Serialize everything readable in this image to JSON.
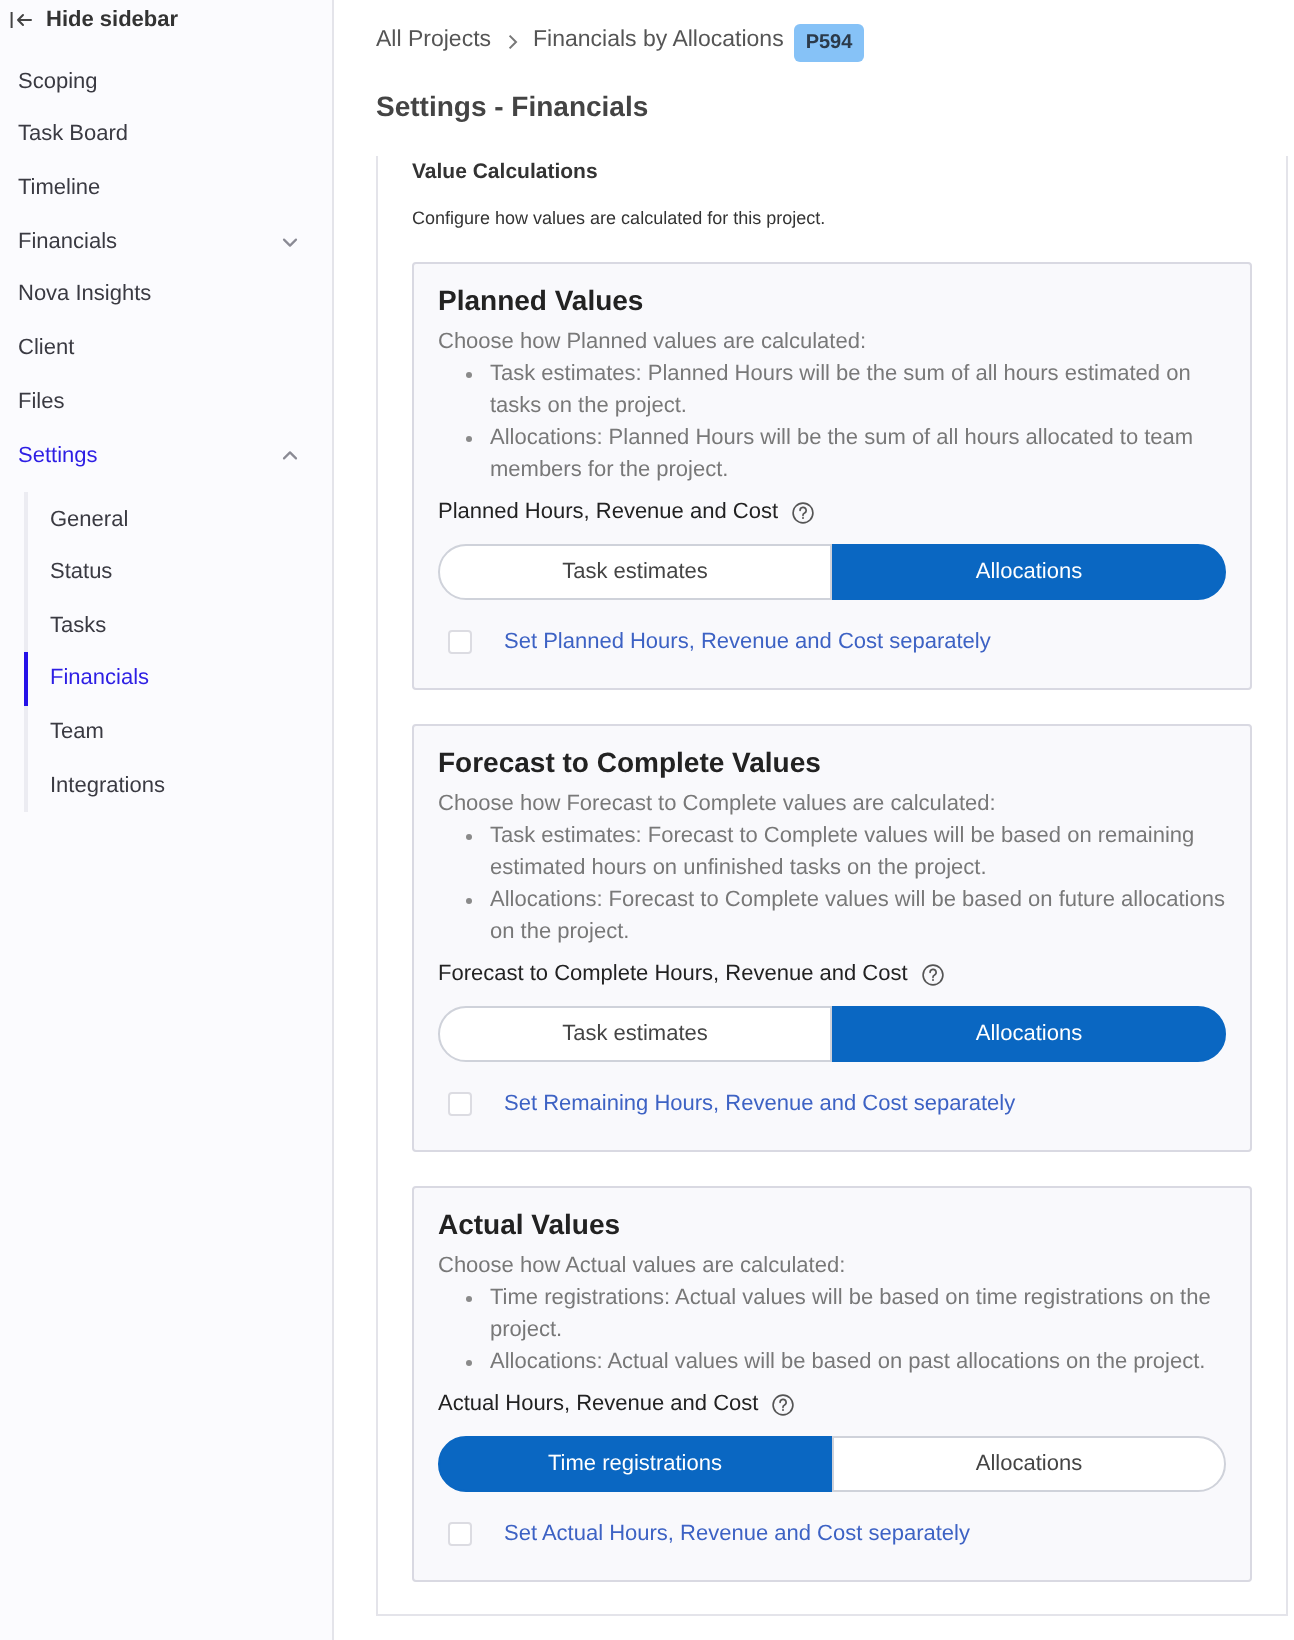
{
  "sidebar": {
    "hide_label": "Hide sidebar",
    "items": [
      {
        "kind": "link",
        "label": "Scoping",
        "selected": false
      },
      {
        "kind": "link",
        "label": "Task Board",
        "selected": false
      },
      {
        "kind": "link",
        "label": "Timeline",
        "selected": false
      },
      {
        "kind": "group",
        "label": "Financials",
        "selected": false,
        "expanded": false
      },
      {
        "kind": "link",
        "label": "Nova Insights",
        "selected": false
      },
      {
        "kind": "link",
        "label": "Client",
        "selected": false
      },
      {
        "kind": "link",
        "label": "Files",
        "selected": false
      },
      {
        "kind": "group",
        "label": "Settings",
        "selected": true,
        "expanded": true,
        "children": [
          {
            "label": "General",
            "selected": false
          },
          {
            "label": "Status",
            "selected": false
          },
          {
            "label": "Tasks",
            "selected": false
          },
          {
            "label": "Financials",
            "selected": true
          },
          {
            "label": "Team",
            "selected": false
          },
          {
            "label": "Integrations",
            "selected": false
          }
        ]
      }
    ]
  },
  "breadcrumb": {
    "items": [
      "All Projects",
      "Financials by Allocations"
    ],
    "badge": "P594"
  },
  "page_title": "Settings - Financials",
  "value_calculations": {
    "title": "Value Calculations",
    "description": "Configure how values are calculated for this project.",
    "cards": [
      {
        "title": "Planned Values",
        "intro": "Choose how Planned values are calculated:",
        "bullets": [
          "Task estimates: Planned Hours will be the sum of all hours estimated on tasks on the project.",
          "Allocations: Planned Hours will be the sum of all hours allocated to team members for the project."
        ],
        "field_label": "Planned Hours, Revenue and Cost",
        "options": [
          {
            "label": "Task estimates",
            "selected": false
          },
          {
            "label": "Allocations",
            "selected": true
          }
        ],
        "checkbox": {
          "label": "Set Planned Hours, Revenue and Cost separately",
          "checked": false
        }
      },
      {
        "title": "Forecast to Complete Values",
        "intro": "Choose how Forecast to Complete values are calculated:",
        "bullets": [
          "Task estimates: Forecast to Complete values will be based on remaining estimated hours on unfinished tasks on the project.",
          "Allocations: Forecast to Complete values will be based on future allocations on the project."
        ],
        "field_label": "Forecast to Complete Hours, Revenue and Cost",
        "options": [
          {
            "label": "Task estimates",
            "selected": false
          },
          {
            "label": "Allocations",
            "selected": true
          }
        ],
        "checkbox": {
          "label": "Set Remaining Hours, Revenue and Cost separately",
          "checked": false
        }
      },
      {
        "title": "Actual Values",
        "intro": "Choose how Actual values are calculated:",
        "bullets": [
          "Time registrations: Actual values will be based on time registrations on the project.",
          "Allocations: Actual values will be based on past allocations on the project."
        ],
        "field_label": "Actual Hours, Revenue and Cost",
        "options": [
          {
            "label": "Time registrations",
            "selected": true
          },
          {
            "label": "Allocations",
            "selected": false
          }
        ],
        "checkbox": {
          "label": "Set Actual Hours, Revenue and Cost separately",
          "checked": false
        }
      }
    ]
  }
}
